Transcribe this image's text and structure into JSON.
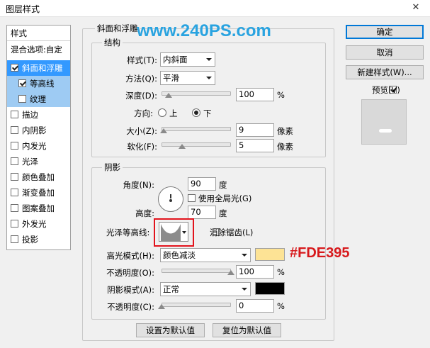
{
  "window": {
    "title": "图层样式",
    "close_glyph": "✕"
  },
  "watermark": "www.240PS.com",
  "annotation": "#FDE395",
  "sidebar": {
    "header": "样式",
    "blend_options": "混合选项:自定",
    "items": [
      {
        "label": "斜面和浮雕",
        "checked": true
      },
      {
        "label": "等高线",
        "checked": true
      },
      {
        "label": "纹理",
        "checked": false
      },
      {
        "label": "描边",
        "checked": false
      },
      {
        "label": "内阴影",
        "checked": false
      },
      {
        "label": "内发光",
        "checked": false
      },
      {
        "label": "光泽",
        "checked": false
      },
      {
        "label": "颜色叠加",
        "checked": false
      },
      {
        "label": "渐变叠加",
        "checked": false
      },
      {
        "label": "图案叠加",
        "checked": false
      },
      {
        "label": "外发光",
        "checked": false
      },
      {
        "label": "投影",
        "checked": false
      }
    ]
  },
  "bevel": {
    "group_title": "斜面和浮雕",
    "structure_title": "结构",
    "style_label": "样式(T):",
    "style_value": "内斜面",
    "technique_label": "方法(Q):",
    "technique_value": "平滑",
    "depth_label": "深度(D):",
    "depth_value": "100",
    "depth_unit": "%",
    "depth_fraction": 0.1,
    "direction_label": "方向:",
    "direction_up": "上",
    "direction_down": "下",
    "direction_selected": "down",
    "size_label": "大小(Z):",
    "size_value": "9",
    "size_unit": "像素",
    "size_fraction": 0.03,
    "soften_label": "软化(F):",
    "soften_value": "5",
    "soften_unit": "像素",
    "soften_fraction": 0.3
  },
  "shading": {
    "title": "阴影",
    "angle_label": "角度(N):",
    "angle_value": "90",
    "angle_unit": "度",
    "global_light_label": "使用全局光(G)",
    "global_light_checked": false,
    "altitude_label": "高度:",
    "altitude_value": "70",
    "altitude_unit": "度",
    "gloss_contour_label": "光泽等高线:",
    "anti_alias_label": "消除锯齿(L)",
    "anti_alias_checked": false,
    "highlight_mode_label": "高光模式(H):",
    "highlight_mode_value": "颜色减淡",
    "highlight_color": "#FDE395",
    "highlight_opacity_label": "不透明度(O):",
    "highlight_opacity_value": "100",
    "highlight_opacity_unit": "%",
    "highlight_opacity_fraction": 1.0,
    "shadow_mode_label": "阴影模式(A):",
    "shadow_mode_value": "正常",
    "shadow_color": "#000000",
    "shadow_opacity_label": "不透明度(C):",
    "shadow_opacity_value": "0",
    "shadow_opacity_unit": "%",
    "shadow_opacity_fraction": 0.0
  },
  "buttons": {
    "ok": "确定",
    "cancel": "取消",
    "new_style": "新建样式(W)...",
    "preview_label": "预览(V)",
    "preview_checked": true,
    "make_default": "设置为默认值",
    "reset_default": "复位为默认值"
  },
  "colors": {
    "accent": "#3399ff",
    "watermark": "#29a3e0",
    "annotation_text": "#d7191c",
    "highlight_box": "#e2131c"
  }
}
